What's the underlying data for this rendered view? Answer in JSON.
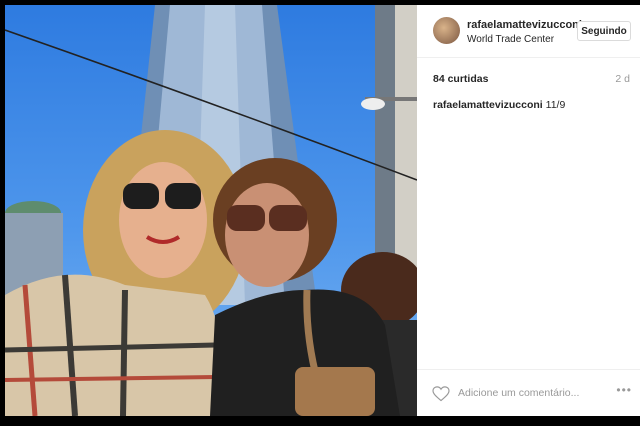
{
  "post": {
    "username": "rafaelamattevizucconi",
    "location": "World Trade Center",
    "follow_label": "Seguindo",
    "likes": "84 curtidas",
    "time": "2 d",
    "caption_user": "rafaelamattevizucconi",
    "caption_text": " 11/9",
    "comment_placeholder": "Adicione um comentário...",
    "more_icon": "•••"
  }
}
